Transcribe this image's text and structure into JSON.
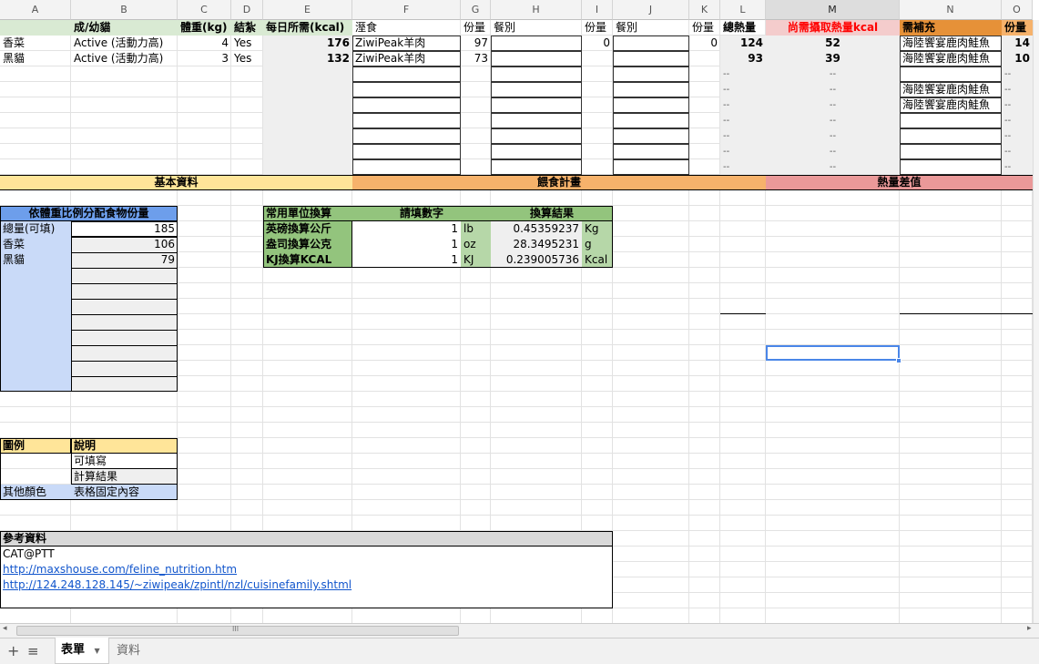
{
  "columns": [
    "A",
    "B",
    "C",
    "D",
    "E",
    "F",
    "G",
    "H",
    "I",
    "J",
    "K",
    "L",
    "M",
    "N",
    "O"
  ],
  "header_row": [
    "",
    "成/幼貓",
    "體重(kg)",
    "結紮",
    "每日所需(kcal)",
    "溼食",
    "份量",
    "餐別",
    "份量",
    "餐別",
    "份量",
    "總熱量",
    "尚需攝取熱量kcal",
    "需補充",
    "份量"
  ],
  "cats": [
    {
      "name": "香菜",
      "activity": "Active (活動力高)",
      "weight": "4",
      "neutered": "Yes",
      "daily_kcal": "176",
      "wet_food": "ZiwiPeak羊肉",
      "portion1": "97",
      "portion2": "0",
      "portion3": "0",
      "total_kcal": "124",
      "remaining_kcal": "52",
      "supplement": "海陸饗宴鹿肉鮭魚",
      "supp_portion": "14"
    },
    {
      "name": "黑貓",
      "activity": "Active (活動力高)",
      "weight": "3",
      "neutered": "Yes",
      "daily_kcal": "132",
      "wet_food": "ZiwiPeak羊肉",
      "portion1": "73",
      "portion2": "",
      "portion3": "",
      "total_kcal": "93",
      "remaining_kcal": "39",
      "supplement": "海陸饗宴鹿肉鮭魚",
      "supp_portion": "10"
    }
  ],
  "placeholder": "--",
  "extra_supplements": [
    "海陸饗宴鹿肉鮭魚",
    "海陸饗宴鹿肉鮭魚"
  ],
  "sections": {
    "basic": "基本資料",
    "feeding": "餵食計畫",
    "diff": "熱量差值"
  },
  "allocation": {
    "title": "依體重比例分配食物份量",
    "rows": [
      {
        "label": "總量(可填)",
        "value": "185"
      },
      {
        "label": "香菜",
        "value": "106"
      },
      {
        "label": "黑貓",
        "value": "79"
      }
    ]
  },
  "conversion": {
    "headers": [
      "常用單位換算",
      "請填數字",
      "換算結果"
    ],
    "rows": [
      {
        "label": "英磅換算公斤",
        "input": "1",
        "unit_in": "lb",
        "result": "0.45359237",
        "unit_out": "Kg"
      },
      {
        "label": "盎司換算公克",
        "input": "1",
        "unit_in": "oz",
        "result": "28.3495231",
        "unit_out": "g"
      },
      {
        "label": "KJ換算KCAL",
        "input": "1",
        "unit_in": "KJ",
        "result": "0.239005736",
        "unit_out": "Kcal"
      }
    ]
  },
  "legend": {
    "headers": [
      "圖例",
      "說明"
    ],
    "rows": [
      {
        "swatch": "",
        "desc": "可填寫"
      },
      {
        "swatch": "",
        "desc": "計算結果"
      },
      {
        "swatch": "其他顏色",
        "desc": "表格固定內容"
      }
    ]
  },
  "references": {
    "title": "參考資料",
    "items": [
      "CAT@PTT"
    ],
    "links": [
      "http://maxshouse.com/feline_nutrition.htm",
      "http://124.248.128.145/~ziwipeak/zpintl/nzl/cuisinefamily.shtml"
    ]
  },
  "tabs": {
    "sheet1": "表單",
    "sheet2": "資料",
    "add": "+",
    "menu": "≡",
    "arrow": "▼"
  },
  "scroll": {
    "left": "◂",
    "right": "▸",
    "thumb": "III"
  },
  "colors": {
    "green": "#d9ead3",
    "yellow": "#ffe599",
    "orange": "#f6b26b",
    "red": "#ea9999",
    "blue": "#c9daf8",
    "darkgreen": "#93c47d",
    "gray": "#efefef",
    "selection": "#4a86e8",
    "supp_header": "#e69138"
  }
}
